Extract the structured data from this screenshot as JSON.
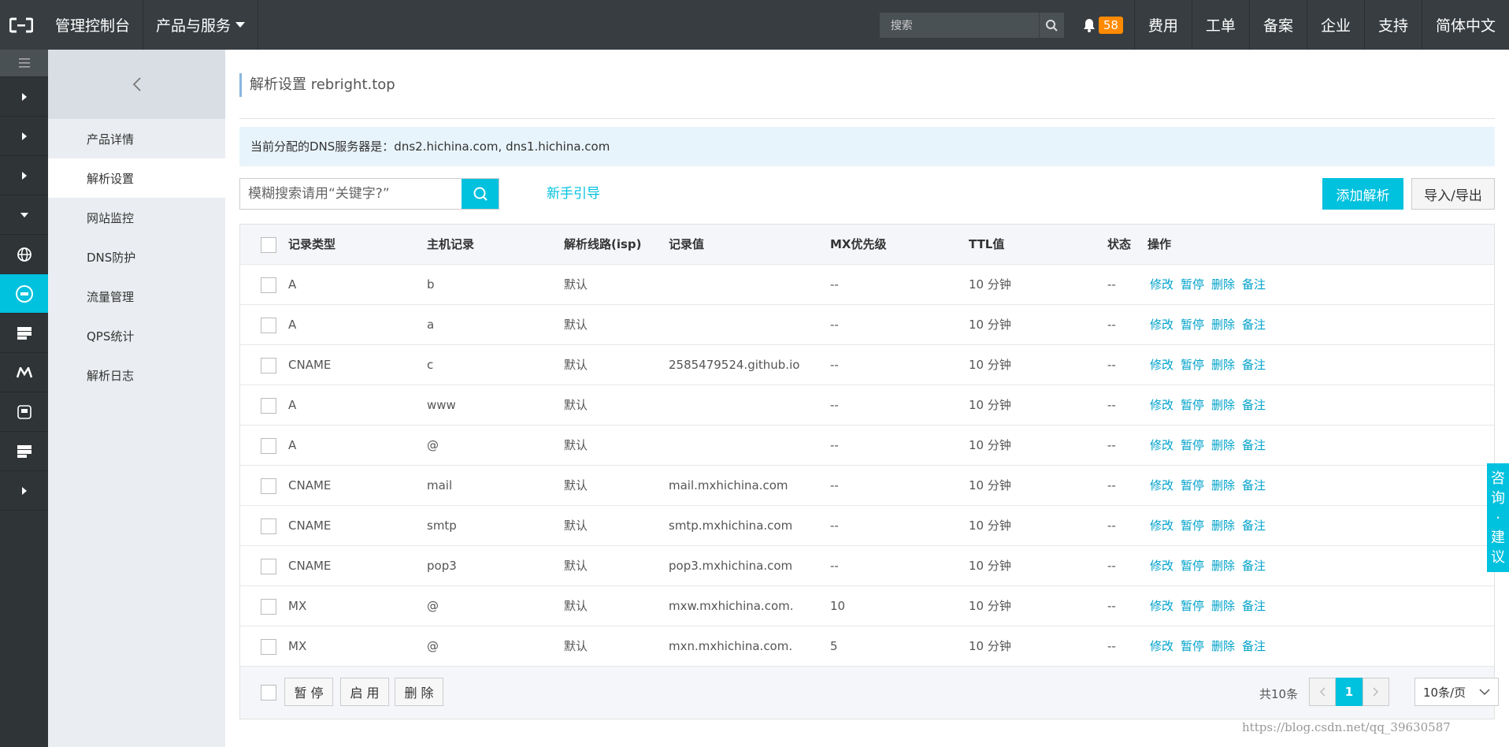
{
  "topbar": {
    "console": "管理控制台",
    "products": "产品与服务",
    "search_label": "搜索",
    "notify_count": "58",
    "nav": [
      "费用",
      "工单",
      "备案",
      "企业",
      "支持",
      "简体中文"
    ]
  },
  "sidebar": {
    "items": [
      {
        "label": "产品详情"
      },
      {
        "label": "解析设置"
      },
      {
        "label": "网站监控"
      },
      {
        "label": "DNS防护"
      },
      {
        "label": "流量管理"
      },
      {
        "label": "QPS统计"
      },
      {
        "label": "解析日志"
      }
    ]
  },
  "main": {
    "title": "解析设置 rebright.top",
    "notice": "当前分配的DNS服务器是：dns2.hichina.com, dns1.hichina.com",
    "search_placeholder": "模糊搜索请用“关键字?”",
    "guide_link": "新手引导",
    "add_button": "添加解析",
    "import_export": "导入/导出"
  },
  "table": {
    "headers": [
      "记录类型",
      "主机记录",
      "解析线路(isp)",
      "记录值",
      "MX优先级",
      "TTL值",
      "状态",
      "操作"
    ],
    "rows": [
      {
        "type": "A",
        "host": "b",
        "line": "默认",
        "value": "",
        "mx": "--",
        "ttl": "10 分钟",
        "status": "--"
      },
      {
        "type": "A",
        "host": "a",
        "line": "默认",
        "value": "",
        "mx": "--",
        "ttl": "10 分钟",
        "status": "--"
      },
      {
        "type": "CNAME",
        "host": "c",
        "line": "默认",
        "value": "2585479524.github.io",
        "mx": "--",
        "ttl": "10 分钟",
        "status": "--"
      },
      {
        "type": "A",
        "host": "www",
        "line": "默认",
        "value": "",
        "mx": "--",
        "ttl": "10 分钟",
        "status": "--"
      },
      {
        "type": "A",
        "host": "@",
        "line": "默认",
        "value": "",
        "mx": "--",
        "ttl": "10 分钟",
        "status": "--"
      },
      {
        "type": "CNAME",
        "host": "mail",
        "line": "默认",
        "value": "mail.mxhichina.com",
        "mx": "--",
        "ttl": "10 分钟",
        "status": "--"
      },
      {
        "type": "CNAME",
        "host": "smtp",
        "line": "默认",
        "value": "smtp.mxhichina.com",
        "mx": "--",
        "ttl": "10 分钟",
        "status": "--"
      },
      {
        "type": "CNAME",
        "host": "pop3",
        "line": "默认",
        "value": "pop3.mxhichina.com",
        "mx": "--",
        "ttl": "10 分钟",
        "status": "--"
      },
      {
        "type": "MX",
        "host": "@",
        "line": "默认",
        "value": "mxw.mxhichina.com.",
        "mx": "10",
        "ttl": "10 分钟",
        "status": "--"
      },
      {
        "type": "MX",
        "host": "@",
        "line": "默认",
        "value": "mxn.mxhichina.com.",
        "mx": "5",
        "ttl": "10 分钟",
        "status": "--"
      }
    ],
    "ops": [
      "修改",
      "暂停",
      "删除",
      "备注"
    ]
  },
  "footer": {
    "pause": "暂 停",
    "enable": "启 用",
    "delete": "删 除",
    "total": "共10条",
    "page": "1",
    "page_size": "10条/页"
  },
  "float_tab": [
    "咨",
    "询",
    "·",
    "建",
    "议"
  ],
  "watermark": "https://blog.csdn.net/qq_39630587",
  "colors": {
    "accent": "#00c1de",
    "topbar": "#373d41",
    "link": "#00a2ca"
  }
}
